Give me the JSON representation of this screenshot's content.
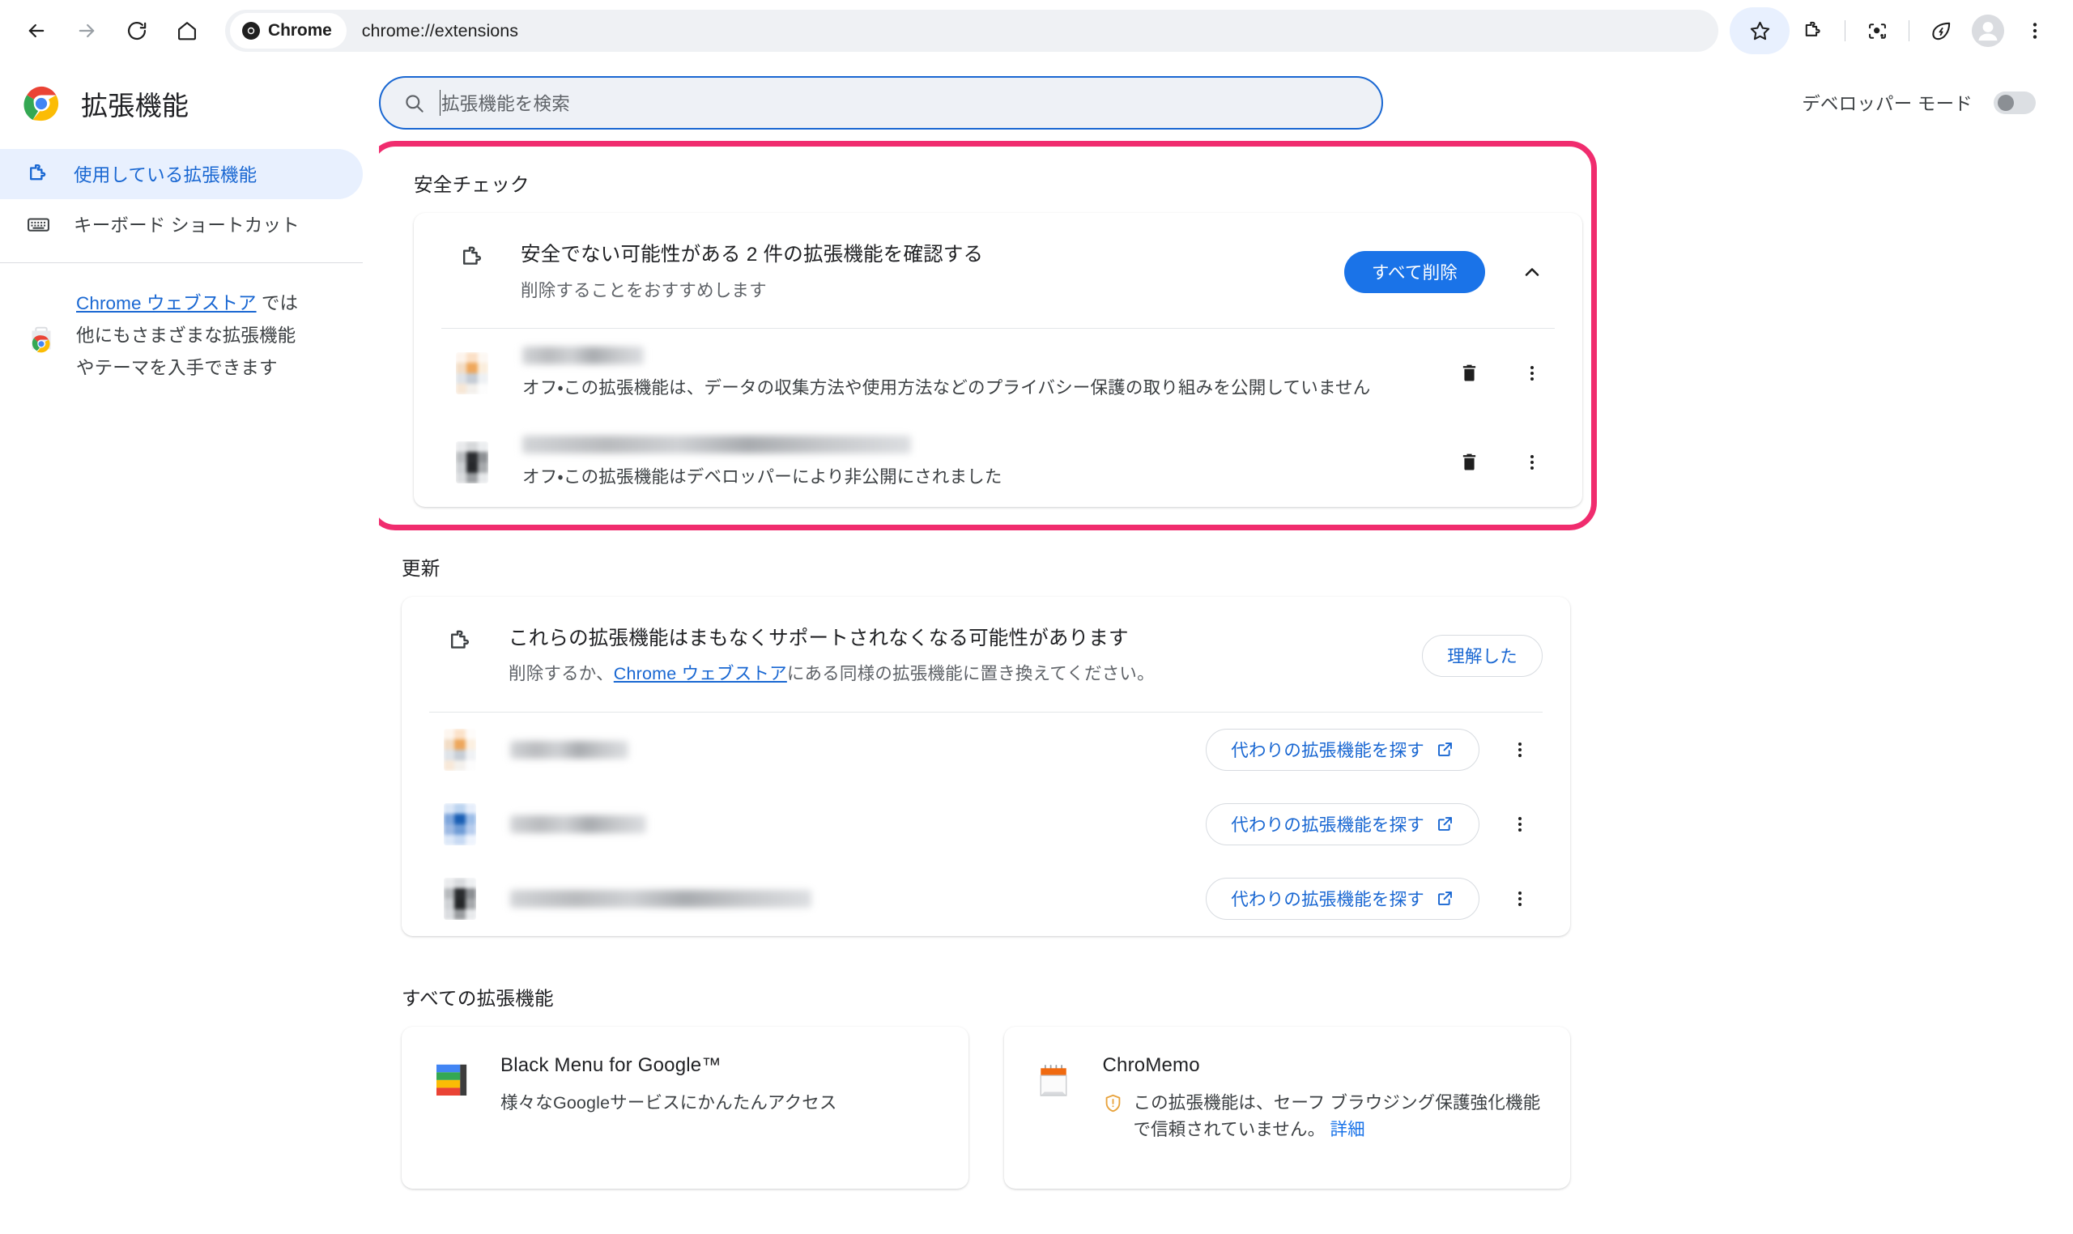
{
  "browser": {
    "nav": {
      "back": "back-arrow",
      "forward": "forward-arrow",
      "reload": "reload",
      "home": "home"
    },
    "omnibox": {
      "chip_label": "Chrome",
      "url": "chrome://extensions"
    },
    "right_icons": [
      "star-icon",
      "extensions-puzzle-icon",
      "google-lens-icon",
      "energy-saver-leaf-icon",
      "profile-avatar",
      "chrome-menu-icon"
    ]
  },
  "sidebar": {
    "brand_title": "拡張機能",
    "items": [
      {
        "label": "使用している拡張機能",
        "icon": "puzzle-icon",
        "active": true
      },
      {
        "label": "キーボード ショートカット",
        "icon": "keyboard-icon",
        "active": false
      }
    ],
    "webstore": {
      "link_text": "Chrome ウェブストア",
      "after_link": " では",
      "line2": "他にもさまざまな拡張機能",
      "line3": "やテーマを入手できます"
    }
  },
  "toolbar": {
    "search_placeholder": "拡張機能を検索",
    "devmode_label": "デベロッパー モード",
    "devmode_on": false
  },
  "safety_check": {
    "section_title": "安全チェック",
    "title": "安全でない可能性がある 2 件の拡張機能を確認する",
    "subtitle": "削除することをおすすめします",
    "remove_all_label": "すべて削除",
    "collapse_icon": "chevron-up-icon",
    "items": [
      {
        "name_redacted": true,
        "description": "オフ・この拡張機能は、データの収集方法や使用方法などのプライバシー保護の取り組みを公開していません",
        "delete_icon": "trash-icon",
        "more_icon": "more-vert-icon"
      },
      {
        "name_redacted": true,
        "description": "オフ・この拡張機能はデベロッパーにより非公開にされました",
        "delete_icon": "trash-icon",
        "more_icon": "more-vert-icon"
      }
    ]
  },
  "updates": {
    "section_title": "更新",
    "title": "これらの拡張機能はまもなくサポートされなくなる可能性があります",
    "subtitle_pre": "削除するか、",
    "subtitle_link": "Chrome ウェブストア",
    "subtitle_post": "にある同様の拡張機能に置き換えてください。",
    "ack_label": "理解した",
    "items": [
      {
        "name_redacted": true,
        "action_label": "代わりの拡張機能を探す",
        "action_icon": "open-in-new-icon",
        "more_icon": "more-vert-icon"
      },
      {
        "name_redacted": true,
        "action_label": "代わりの拡張機能を探す",
        "action_icon": "open-in-new-icon",
        "more_icon": "more-vert-icon"
      },
      {
        "name_redacted": true,
        "action_label": "代わりの拡張機能を探す",
        "action_icon": "open-in-new-icon",
        "more_icon": "more-vert-icon"
      }
    ]
  },
  "all_extensions": {
    "section_title": "すべての拡張機能",
    "cards": [
      {
        "name": "Black Menu for Google™",
        "description": "様々なGoogleサービスにかんたんアクセス",
        "has_warning": false
      },
      {
        "name": "ChroMemo",
        "warning_text": "この拡張機能は、セーフ ブラウジング保護強化機能で信頼されていません。",
        "warning_link": "詳細",
        "has_warning": true
      }
    ]
  },
  "annotation": {
    "highlight_color": "#f02c6e",
    "highlight_target": "safety-check-section"
  },
  "colors": {
    "accent_blue": "#1a73e8",
    "link_blue": "#1967d2",
    "active_nav_bg": "#e8f0fe",
    "text_primary": "#202124",
    "text_secondary": "#5f6368",
    "page_bg": "#ffffff"
  }
}
